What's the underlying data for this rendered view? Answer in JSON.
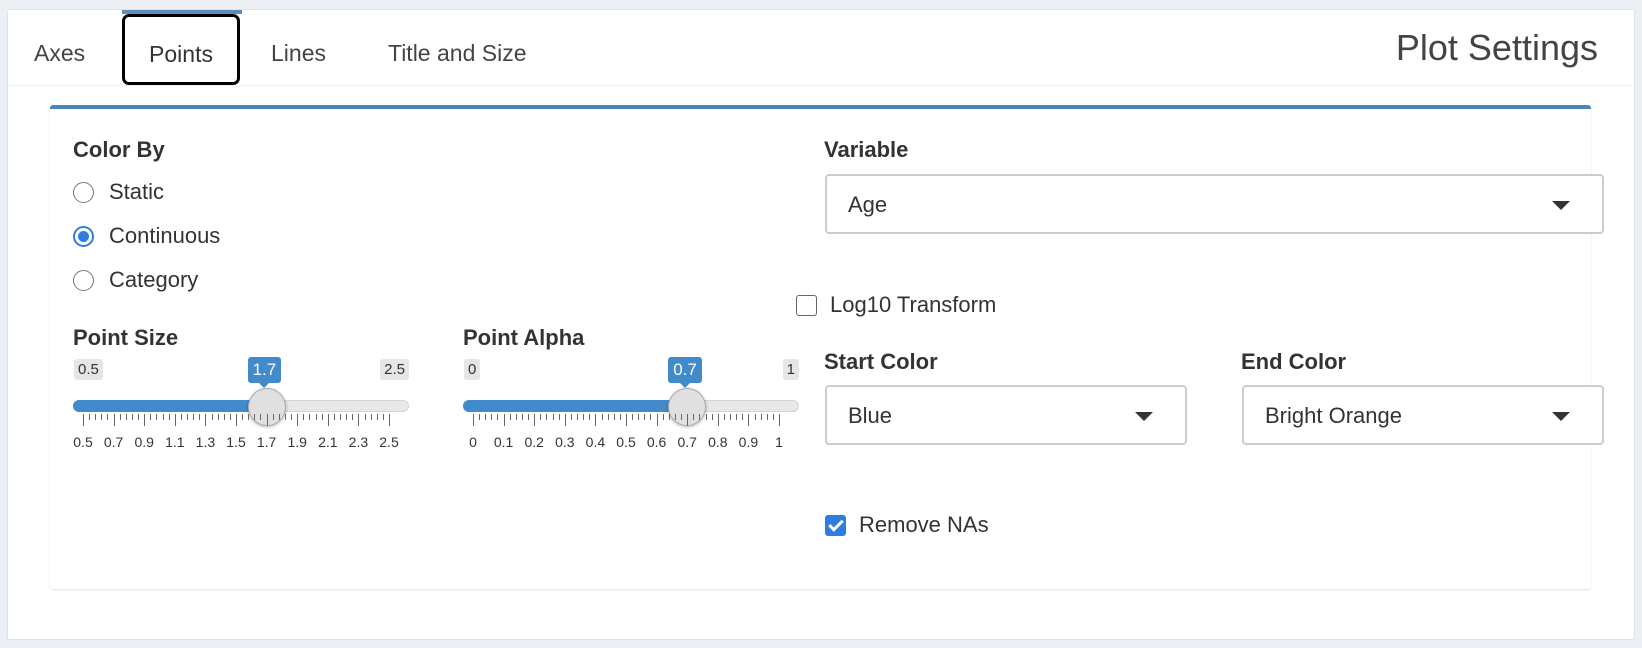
{
  "tabs": [
    {
      "label": "Axes"
    },
    {
      "label": "Points",
      "active": true
    },
    {
      "label": "Lines"
    },
    {
      "label": "Title and Size"
    }
  ],
  "header_title": "Plot Settings",
  "color_by": {
    "label": "Color By",
    "options": [
      {
        "label": "Static",
        "checked": false
      },
      {
        "label": "Continuous",
        "checked": true
      },
      {
        "label": "Category",
        "checked": false
      }
    ]
  },
  "variable": {
    "label": "Variable",
    "value": "Age"
  },
  "log10": {
    "label": "Log10 Transform",
    "checked": false
  },
  "point_size": {
    "label": "Point Size",
    "min": 0.5,
    "max": 2.5,
    "value": 1.7,
    "min_label": "0.5",
    "max_label": "2.5",
    "value_label": "1.7",
    "tick_labels": [
      "0.5",
      "0.7",
      "0.9",
      "1.1",
      "1.3",
      "1.5",
      "1.7",
      "1.9",
      "2.1",
      "2.3",
      "2.5"
    ]
  },
  "point_alpha": {
    "label": "Point Alpha",
    "min": 0,
    "max": 1,
    "value": 0.7,
    "min_label": "0",
    "max_label": "1",
    "value_label": "0.7",
    "tick_labels": [
      "0",
      "0.1",
      "0.2",
      "0.3",
      "0.4",
      "0.5",
      "0.6",
      "0.7",
      "0.8",
      "0.9",
      "1"
    ]
  },
  "start_color": {
    "label": "Start Color",
    "value": "Blue"
  },
  "end_color": {
    "label": "End Color",
    "value": "Bright Orange"
  },
  "remove_nas": {
    "label": "Remove NAs",
    "checked": true
  },
  "colors": {
    "accent": "#428bca",
    "panel_border": "#4a86b8",
    "checkbox": "#2f7de1"
  }
}
